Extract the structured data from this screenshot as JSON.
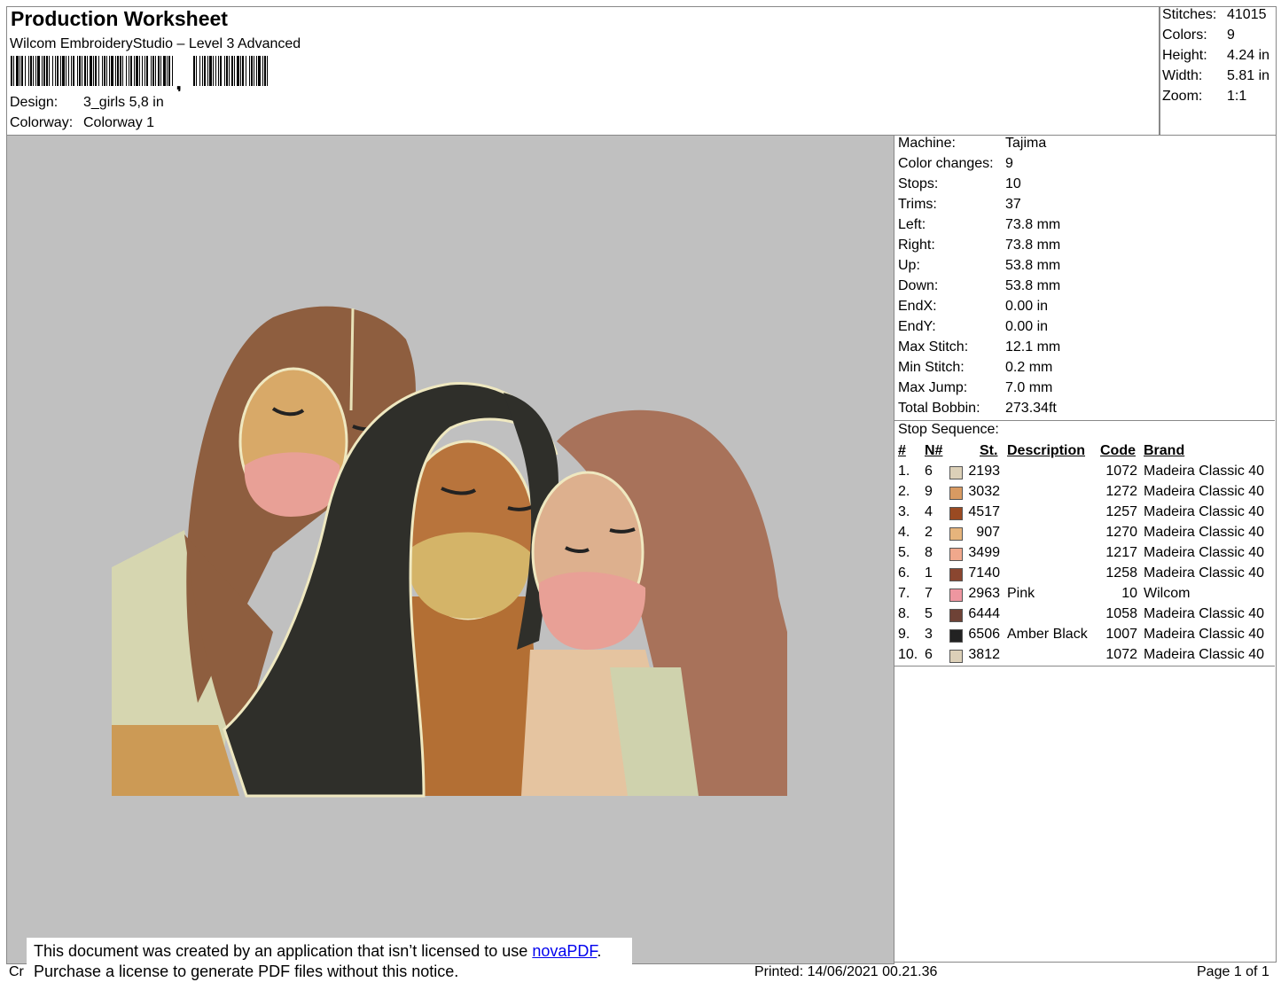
{
  "header": {
    "title": "Production Worksheet",
    "software": "Wilcom EmbroideryStudio – Level 3 Advanced",
    "design_label": "Design:",
    "design_value": "3_girls 5,8 in",
    "colorway_label": "Colorway:",
    "colorway_value": "Colorway 1"
  },
  "summary": [
    {
      "label": "Stitches:",
      "value": "41015"
    },
    {
      "label": "Colors:",
      "value": "9"
    },
    {
      "label": "Height:",
      "value": "4.24 in"
    },
    {
      "label": "Width:",
      "value": "5.81 in"
    },
    {
      "label": "Zoom:",
      "value": "1:1"
    }
  ],
  "properties": [
    {
      "label": "Machine:",
      "value": "Tajima"
    },
    {
      "label": "Color changes:",
      "value": "9"
    },
    {
      "label": "Stops:",
      "value": "10"
    },
    {
      "label": "Trims:",
      "value": "37"
    },
    {
      "label": "Left:",
      "value": "73.8 mm"
    },
    {
      "label": "Right:",
      "value": "73.8 mm"
    },
    {
      "label": "Up:",
      "value": "53.8 mm"
    },
    {
      "label": "Down:",
      "value": "53.8 mm"
    },
    {
      "label": "EndX:",
      "value": "0.00 in"
    },
    {
      "label": "EndY:",
      "value": "0.00 in"
    },
    {
      "label": "Max Stitch:",
      "value": "12.1 mm"
    },
    {
      "label": "Min Stitch:",
      "value": "0.2 mm"
    },
    {
      "label": "Max Jump:",
      "value": "7.0 mm"
    },
    {
      "label": "Total Bobbin:",
      "value": "273.34ft"
    }
  ],
  "stop_sequence": {
    "title": "Stop Sequence:",
    "headers": {
      "num": "#",
      "n": "N#",
      "st": "St.",
      "desc": "Description",
      "code": "Code",
      "brand": "Brand"
    },
    "rows": [
      {
        "num": "1.",
        "n": "6",
        "color": "#dcd0b8",
        "st": "2193",
        "desc": "",
        "code": "1072",
        "brand": "Madeira Classic 40"
      },
      {
        "num": "2.",
        "n": "9",
        "color": "#d89a62",
        "st": "3032",
        "desc": "",
        "code": "1272",
        "brand": "Madeira Classic 40"
      },
      {
        "num": "3.",
        "n": "4",
        "color": "#9a4a22",
        "st": "4517",
        "desc": "",
        "code": "1257",
        "brand": "Madeira Classic 40"
      },
      {
        "num": "4.",
        "n": "2",
        "color": "#e6b47c",
        "st": "907",
        "desc": "",
        "code": "1270",
        "brand": "Madeira Classic 40"
      },
      {
        "num": "5.",
        "n": "8",
        "color": "#f0a88c",
        "st": "3499",
        "desc": "",
        "code": "1217",
        "brand": "Madeira Classic 40"
      },
      {
        "num": "6.",
        "n": "1",
        "color": "#8a4630",
        "st": "7140",
        "desc": "",
        "code": "1258",
        "brand": "Madeira Classic 40"
      },
      {
        "num": "7.",
        "n": "7",
        "color": "#ee96a0",
        "st": "2963",
        "desc": "Pink",
        "code": "10",
        "brand": "Wilcom"
      },
      {
        "num": "8.",
        "n": "5",
        "color": "#6e4236",
        "st": "6444",
        "desc": "",
        "code": "1058",
        "brand": "Madeira Classic 40"
      },
      {
        "num": "9.",
        "n": "3",
        "color": "#222222",
        "st": "6506",
        "desc": "Amber Black",
        "code": "1007",
        "brand": "Madeira Classic 40"
      },
      {
        "num": "10.",
        "n": "6",
        "color": "#dcd0b8",
        "st": "3812",
        "desc": "",
        "code": "1072",
        "brand": "Madeira Classic 40"
      }
    ]
  },
  "notice": {
    "line1": "This document was created by an application that isn’t licensed to use ",
    "link": "novaPDF",
    "line1_end": ".",
    "line2": "Purchase a license to generate PDF files without this notice."
  },
  "footer": {
    "left": "Cr",
    "printed": "Printed: 14/06/2021 00.21.36",
    "page": "Page 1 of 1"
  }
}
